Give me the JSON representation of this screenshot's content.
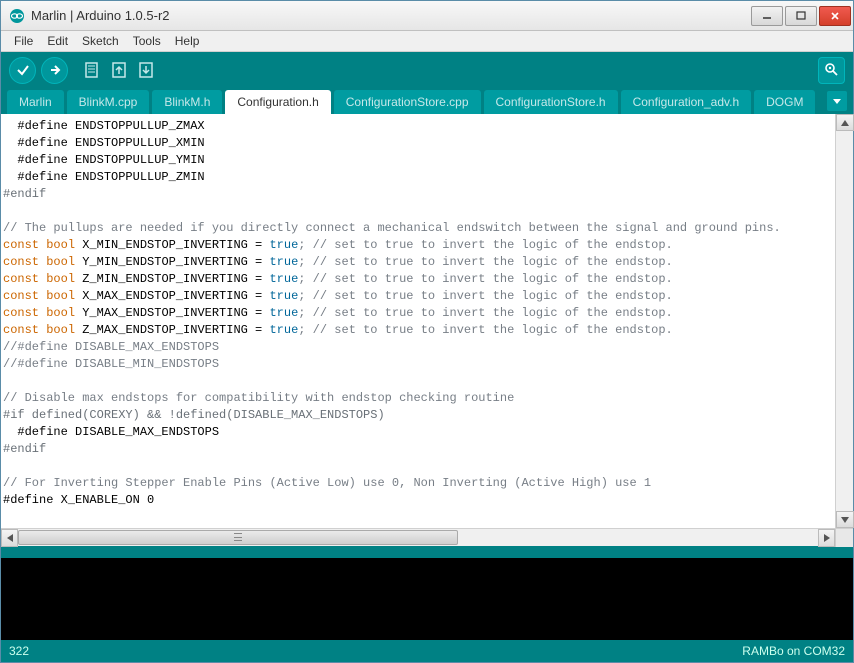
{
  "window": {
    "title": "Marlin | Arduino 1.0.5-r2"
  },
  "menu": {
    "file": "File",
    "edit": "Edit",
    "sketch": "Sketch",
    "tools": "Tools",
    "help": "Help"
  },
  "tabs": [
    {
      "label": "Marlin",
      "active": false
    },
    {
      "label": "BlinkM.cpp",
      "active": false
    },
    {
      "label": "BlinkM.h",
      "active": false
    },
    {
      "label": "Configuration.h",
      "active": true
    },
    {
      "label": "ConfigurationStore.cpp",
      "active": false
    },
    {
      "label": "ConfigurationStore.h",
      "active": false
    },
    {
      "label": "Configuration_adv.h",
      "active": false
    },
    {
      "label": "DOGM",
      "active": false
    }
  ],
  "code": {
    "l1": "  #define ENDSTOPPULLUP_ZMAX",
    "l2": "  #define ENDSTOPPULLUP_XMIN",
    "l3": "  #define ENDSTOPPULLUP_YMIN",
    "l4": "  #define ENDSTOPPULLUP_ZMIN",
    "l5": "#endif",
    "l7_comment": "// The pullups are needed if you directly connect a mechanical endswitch between the signal and ground pins.",
    "l8_const": "const",
    "l8_bool": "bool",
    "l8_name": " X_MIN_ENDSTOP_INVERTING = ",
    "l8_true": "true",
    "l8_comment": "; // set to true to invert the logic of the endstop.",
    "l9_name": " Y_MIN_ENDSTOP_INVERTING = ",
    "l10_name": " Z_MIN_ENDSTOP_INVERTING = ",
    "l11_name": " X_MAX_ENDSTOP_INVERTING = ",
    "l12_name": " Y_MAX_ENDSTOP_INVERTING = ",
    "l13_name": " Z_MAX_ENDSTOP_INVERTING = ",
    "l14": "//#define DISABLE_MAX_ENDSTOPS",
    "l15": "//#define DISABLE_MIN_ENDSTOPS",
    "l17": "// Disable max endstops for compatibility with endstop checking routine",
    "l18": "#if defined(COREXY) && !defined(DISABLE_MAX_ENDSTOPS)",
    "l19": "  #define DISABLE_MAX_ENDSTOPS",
    "l20": "#endif",
    "l22": "// For Inverting Stepper Enable Pins (Active Low) use 0, Non Inverting (Active High) use 1",
    "l23": "#define X_ENABLE_ON 0"
  },
  "footer": {
    "line": "322",
    "board": "RAMBo on COM32"
  }
}
